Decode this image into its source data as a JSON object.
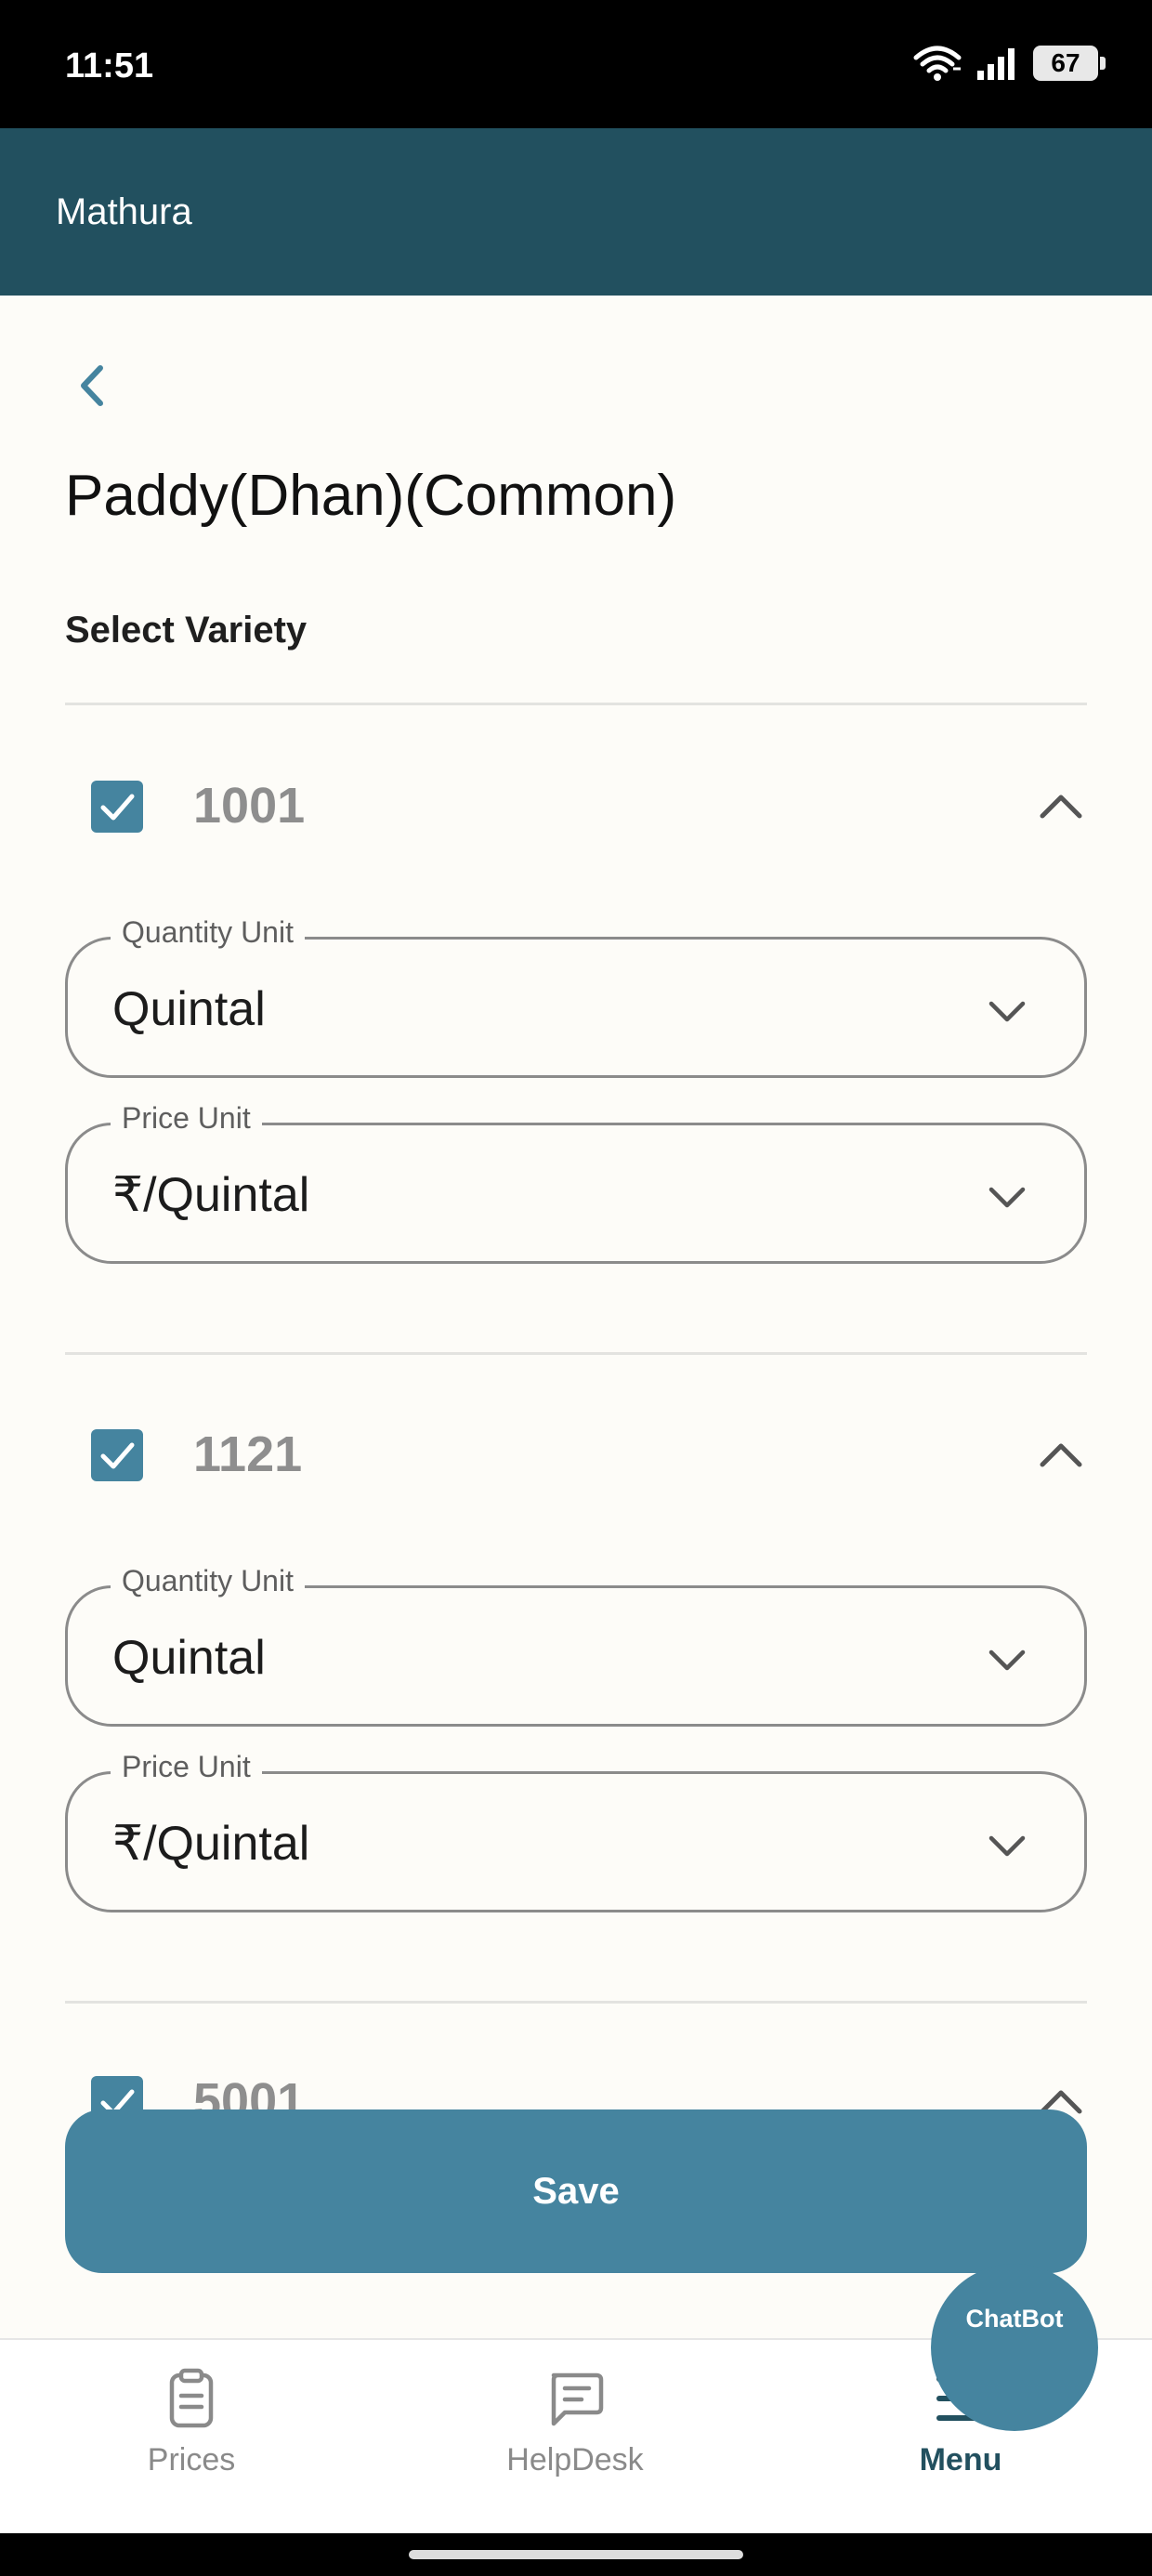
{
  "status_bar": {
    "time": "11:51",
    "battery": "67"
  },
  "header": {
    "title": "Mathura"
  },
  "page": {
    "title": "Paddy(Dhan)(Common)",
    "section_label": "Select Variety"
  },
  "varieties": [
    {
      "name": "1001",
      "checked": true,
      "quantity_label": "Quantity Unit",
      "quantity_value": "Quintal",
      "price_label": "Price Unit",
      "price_value": "₹/Quintal"
    },
    {
      "name": "1121",
      "checked": true,
      "quantity_label": "Quantity Unit",
      "quantity_value": "Quintal",
      "price_label": "Price Unit",
      "price_value": "₹/Quintal"
    },
    {
      "name": "5001",
      "checked": true
    }
  ],
  "save_button": {
    "label": "Save"
  },
  "chatbot": {
    "label": "ChatBot"
  },
  "bottom_nav": {
    "items": [
      {
        "label": "Prices",
        "icon": "clipboard-icon",
        "active": false
      },
      {
        "label": "HelpDesk",
        "icon": "chat-icon",
        "active": false
      },
      {
        "label": "Menu",
        "icon": "menu-icon",
        "active": true
      }
    ]
  },
  "colors": {
    "app_bar": "#22505f",
    "accent": "#45849f",
    "background": "#fdfcf8"
  }
}
